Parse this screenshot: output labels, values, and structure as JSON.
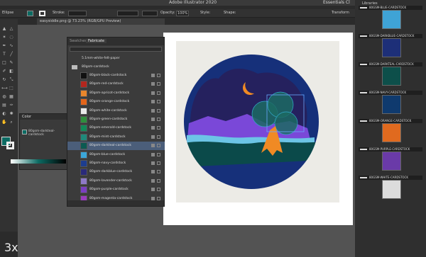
{
  "app": {
    "title": "Adobe Illustrator 2020",
    "workspace": "Essentials Cl",
    "status_left": "Ellipse"
  },
  "control_bar": {
    "stroke_label": "Stroke:",
    "opacity_label": "Opacity:",
    "opacity_value": "100%",
    "style_label": "Style:",
    "shape_label": "Shape:",
    "transform_label": "Transform"
  },
  "document": {
    "tab": "easysiddle.png @ 73.23% (RGB/GPU Preview)"
  },
  "color_panel": {
    "title": "Color",
    "current_name": "80gsm-darkteal-cardstock"
  },
  "swatches_panel": {
    "tab_swatches": "Swatches",
    "tab_fabricate": "Fabricate",
    "group_label": "5.1mm-white-felt-paper",
    "folder_label": "80gsm-cardstock",
    "rows": [
      {
        "name": "80gsm-black-cardstock",
        "color": "#111111",
        "selected": false
      },
      {
        "name": "80gsm-red-cardstock",
        "color": "#b3261e",
        "selected": false
      },
      {
        "name": "80gsm-apricot-cardstock",
        "color": "#e8862c",
        "selected": false
      },
      {
        "name": "80gsm-orange-cardstock",
        "color": "#e3651b",
        "selected": false
      },
      {
        "name": "80gsm-white-cardstock",
        "color": "#e9e9e9",
        "selected": false
      },
      {
        "name": "80gsm-green-cardstock",
        "color": "#2f8f3c",
        "selected": false
      },
      {
        "name": "80gsm-emerald-cardstock",
        "color": "#138a57",
        "selected": false
      },
      {
        "name": "80gsm-mint-cardstock",
        "color": "#1f8a7a",
        "selected": false
      },
      {
        "name": "80gsm-darkteal-cardstock",
        "color": "#0c5a52",
        "selected": true
      },
      {
        "name": "80gsm-blue-cardstock",
        "color": "#3aa6d8",
        "selected": false
      },
      {
        "name": "80gsm-navy-cardstock",
        "color": "#1d3d8f",
        "selected": false
      },
      {
        "name": "80gsm-darkblue-cardstock",
        "color": "#2a2a7a",
        "selected": false
      },
      {
        "name": "80gsm-lavender-cardstock",
        "color": "#8e7ac7",
        "selected": false
      },
      {
        "name": "80gsm-purple-cardstock",
        "color": "#7a3fc2",
        "selected": false
      },
      {
        "name": "80gsm-magenta-cardstock",
        "color": "#9a3dbf",
        "selected": false
      }
    ]
  },
  "libraries_panel": {
    "header": "Libraries",
    "items": [
      {
        "label": "80GSM-BLUE-CARDSTOCK",
        "color": "#3fa3d6"
      },
      {
        "label": "80GSM-DARKBLUE-CARDSTOCK",
        "color": "#1d2f78"
      },
      {
        "label": "80GSM-DARKTEAL-CARDSTOCK",
        "color": "#0d4f4a"
      },
      {
        "label": "80GSM-NAVY-CARDSTOCK",
        "color": "#0f3a6e"
      },
      {
        "label": "80GSM-ORANGE-CARDSTOCK",
        "color": "#e06a1f"
      },
      {
        "label": "80GSM-PURPLE-CARDSTOCK",
        "color": "#6a3aa8"
      },
      {
        "label": "80GSM-WHITE-CARDSTOCK",
        "color": "#dcdcdc"
      }
    ]
  },
  "overlay": {
    "speed": "3x"
  }
}
